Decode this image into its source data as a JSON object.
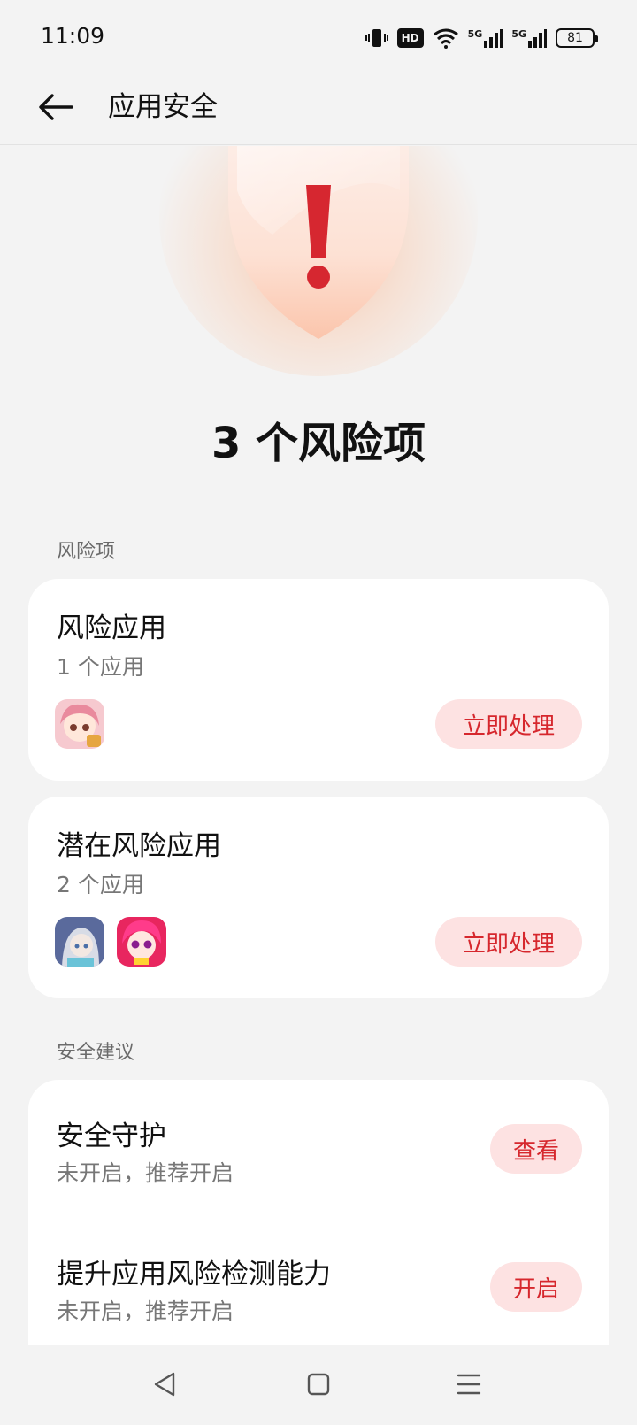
{
  "status_bar": {
    "time": "11:09",
    "hd_label": "HD",
    "signal_1": "5G",
    "signal_2": "5G",
    "battery": "81",
    "icons": [
      "vibrate-icon",
      "hd-icon",
      "wifi-icon",
      "signal-5g-icon",
      "signal-5g-icon",
      "battery-icon"
    ]
  },
  "app_bar": {
    "title": "应用安全",
    "back_icon": "arrow-left-icon"
  },
  "hero": {
    "icon": "shield-warning-icon",
    "mark": "!",
    "risk_count_text": "3 个风险项"
  },
  "sections": {
    "risks_label": "风险项",
    "advice_label": "安全建议"
  },
  "risk_cards": [
    {
      "title": "风险应用",
      "subtitle": "1 个应用",
      "action": "立即处理"
    },
    {
      "title": "潜在风险应用",
      "subtitle": "2 个应用",
      "action": "立即处理"
    }
  ],
  "advice_items": [
    {
      "title": "安全守护",
      "subtitle": "未开启，推荐开启",
      "action": "查看"
    },
    {
      "title": "提升应用风险检测能力",
      "subtitle": "未开启，推荐开启",
      "action": "开启"
    }
  ],
  "nav_bar": {
    "icons": [
      "back-triangle-icon",
      "home-square-icon",
      "menu-lines-icon"
    ]
  },
  "colors": {
    "accent_red": "#d6272d",
    "button_bg": "#fde2e2",
    "background": "#f3f3f3",
    "card_bg": "#ffffff"
  }
}
